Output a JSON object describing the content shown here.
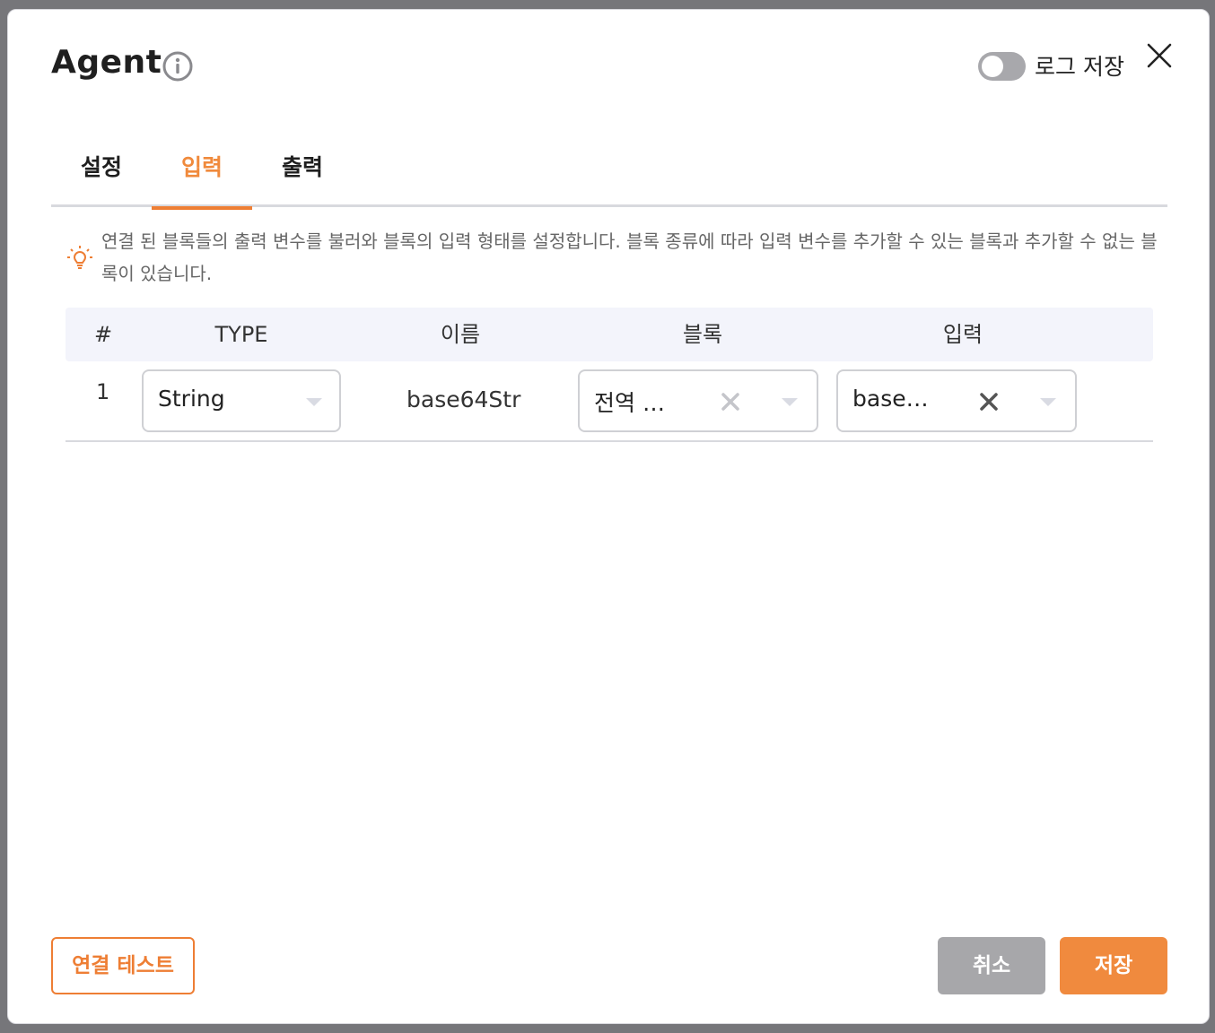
{
  "header": {
    "title": "Agent",
    "log_toggle_label": "로그 저장",
    "log_toggle_on": false
  },
  "tabs": [
    {
      "label": "설정",
      "active": false
    },
    {
      "label": "입력",
      "active": true
    },
    {
      "label": "출력",
      "active": false
    }
  ],
  "notice": {
    "text": "연결 된 블록들의 출력 변수를 불러와 블록의 입력 형태를 설정합니다. 블록 종류에 따라 입력 변수를 추가할 수 있는 블록과 추가할 수 없는 블록이 있습니다."
  },
  "table": {
    "columns": [
      "#",
      "TYPE",
      "이름",
      "블록",
      "입력"
    ],
    "rows": [
      {
        "num": "1",
        "type": "String",
        "name": "base64Str",
        "block": "전역 …",
        "input": "base…"
      }
    ]
  },
  "footer": {
    "test_label": "연결 테스트",
    "cancel_label": "취소",
    "save_label": "저장"
  },
  "colors": {
    "accent": "#ee7e34",
    "toggle_off": "#a8a8ac",
    "cancel": "#a7a7aa"
  }
}
